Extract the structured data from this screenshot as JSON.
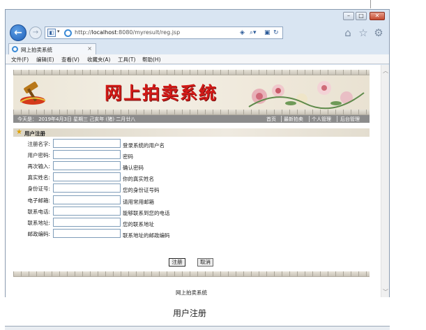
{
  "browser": {
    "url_prefix": "http://",
    "url_host": "localhost",
    "url_path": ":8080/myresult/reg.jsp",
    "tab_title": "网上拍卖系统",
    "menus": [
      "文件(F)",
      "编辑(E)",
      "查看(V)",
      "收藏夹(A)",
      "工具(T)",
      "帮助(H)"
    ]
  },
  "site": {
    "banner_title": "网上拍卖系统",
    "date_text": "今天是：  2019年4月3日  星期三  己亥年 (猪) 二月廿八",
    "nav": [
      "首页",
      "最新拍卖",
      "个人管理",
      "后台管理"
    ],
    "form_title": "用户注册",
    "fields": [
      {
        "label": "注册名字:",
        "hint": "登录系统的用户名"
      },
      {
        "label": "用户密码:",
        "hint": "密码"
      },
      {
        "label": "再次输入:",
        "hint": "确认密码"
      },
      {
        "label": "真实姓名:",
        "hint": "你的真实姓名"
      },
      {
        "label": "身份证号:",
        "hint": "您的身份证号码"
      },
      {
        "label": "电子邮箱:",
        "hint": "请用常用邮箱"
      },
      {
        "label": "联系电话:",
        "hint": "能够联系到您的电话"
      },
      {
        "label": "联系地址:",
        "hint": "您的联系地址"
      },
      {
        "label": "邮政编码:",
        "hint": "联系地址的邮政编码"
      }
    ],
    "submit_label": "注册",
    "cancel_label": "取消",
    "footer": "网上拍卖系统"
  },
  "caption": "用户注册",
  "colors": {
    "banner_title": "#d21a17",
    "status_bar": "#8c8c8c",
    "accent_blue": "#1f5fb8"
  },
  "icons": [
    "back-icon",
    "forward-icon",
    "compat-view-icon",
    "ie-icon",
    "refresh-icon",
    "search-icon",
    "home-icon",
    "favorites-star-icon",
    "settings-gear-icon",
    "star-icon",
    "hammer-icon"
  ]
}
